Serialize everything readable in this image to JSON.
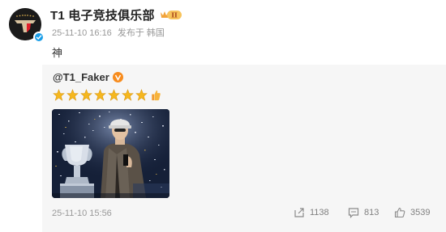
{
  "post": {
    "author_name": "T1 电子竞技俱乐部",
    "badge": "II",
    "timestamp": "25-11-10 16:16",
    "source": "发布于 韩国",
    "text": "神"
  },
  "retweet": {
    "author": "@T1_Faker",
    "emoji_stars": 7,
    "emoji_extra": "thumbs-up",
    "timestamp": "25-11-10 15:56",
    "shares": "1138",
    "comments": "813",
    "likes": "3539"
  },
  "colors": {
    "verified": "#1a9ee8",
    "faker_badge": "#f78c1e",
    "meta_gray": "#999999",
    "retweet_bg": "#f6f6f6",
    "star_gold": "#f5b71e"
  }
}
